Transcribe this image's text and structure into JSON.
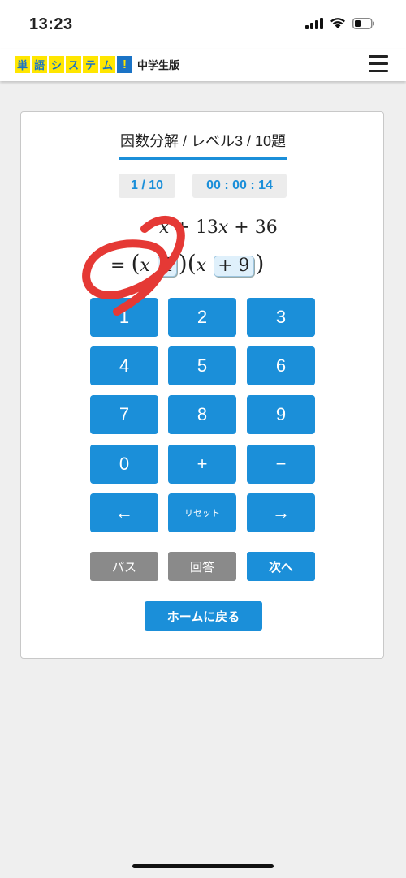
{
  "status_bar": {
    "time": "13:23"
  },
  "header": {
    "logo_chars": [
      "単",
      "語",
      "シ",
      "ス",
      "テ",
      "ム"
    ],
    "logo_exclaim": "!",
    "edition": "中学生版",
    "brand_yellow": "#ffe600",
    "brand_blue": "#1a73c6"
  },
  "quiz": {
    "title": "因数分解 / レベル3 / 10題",
    "progress": "1 / 10",
    "timer": "00 : 00 : 14",
    "equation_line1": {
      "var": "x",
      "rest": "+ 13",
      "var2": "x",
      "tail": "+ 36"
    },
    "equation_line2": {
      "equals": "=",
      "open1": "(",
      "var1": "x",
      "slot1": "4",
      "close1": ")",
      "open2": "(",
      "var2": "x",
      "slot2": "+ 9",
      "close2": ")"
    }
  },
  "keypad": {
    "keys": [
      "1",
      "2",
      "3",
      "4",
      "5",
      "6",
      "7",
      "8",
      "9",
      "0",
      "+",
      "−",
      "←",
      "リセット",
      "→"
    ]
  },
  "actions": {
    "pass": "パス",
    "answer": "回答",
    "next": "次へ"
  },
  "home_button": "ホームに戻る",
  "colors": {
    "accent": "#1b8fd9",
    "gray_button": "#8a8a8a",
    "correct_mark": "#e53935"
  },
  "icons": [
    "signal-icon",
    "wifi-icon",
    "battery-icon",
    "hamburger-menu-icon",
    "left-arrow-icon",
    "right-arrow-icon",
    "correct-circle-mark"
  ]
}
